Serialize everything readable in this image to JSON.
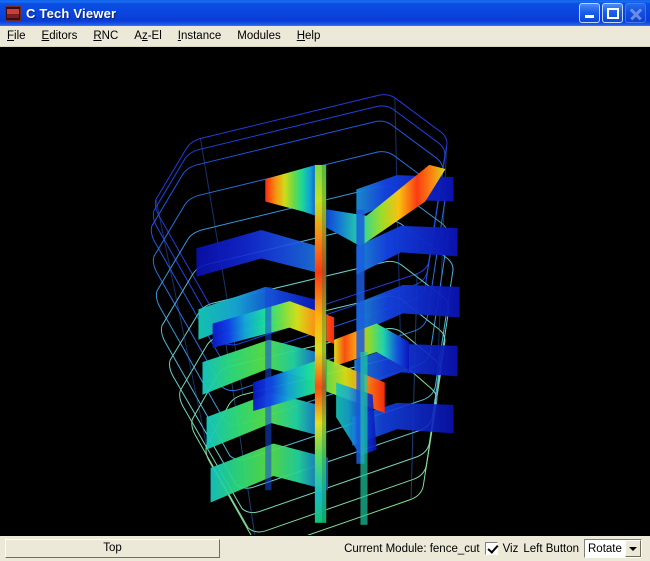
{
  "window": {
    "title": "C Tech Viewer",
    "app_icon": "app-icon",
    "controls": {
      "minimize": "minimize-button",
      "maximize": "maximize-button",
      "close": "close-button"
    }
  },
  "menubar": {
    "items": [
      {
        "label": "File",
        "accel": "F"
      },
      {
        "label": "Editors",
        "accel": "E"
      },
      {
        "label": "RNC",
        "accel": "R"
      },
      {
        "label": "Az-El",
        "accel": "z"
      },
      {
        "label": "Instance",
        "accel": "I"
      },
      {
        "label": "Modules",
        "accel": ""
      },
      {
        "label": "Help",
        "accel": "H"
      }
    ]
  },
  "viewport": {
    "name": "3d-render-viewport",
    "background": "#000000",
    "scene": "fence diagram of vertical cross-section panels with rainbow colormap inside a wireframe site boundary"
  },
  "statusbar": {
    "top_button_label": "Top",
    "current_module_label": "Current Module: fence_cut",
    "viz_checkbox_label": "Viz",
    "viz_checked": true,
    "left_button_label": "Left Button",
    "mouse_mode_value": "Rotate"
  },
  "colors": {
    "title_bar_blue": "#0A46DE",
    "window_border_blue": "#0A3AE0",
    "chrome_beige": "#ECE9D8",
    "viewport_black": "#000000",
    "colormap_low": "#0000C8",
    "colormap_mid": "#00E000",
    "colormap_high": "#FF2000"
  }
}
